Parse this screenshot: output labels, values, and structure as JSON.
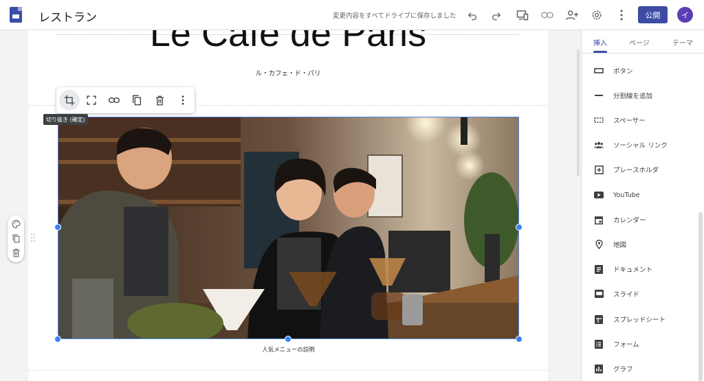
{
  "header": {
    "title": "レストラン",
    "save_status": "変更内容をすべてドライブに保存しました",
    "publish_label": "公開",
    "avatar_initial": "イ",
    "icons": [
      "undo-icon",
      "redo-icon",
      "preview-icon",
      "link-icon",
      "share-icon",
      "settings-icon",
      "more-icon"
    ]
  },
  "page": {
    "hero_title": "Le Café de Paris",
    "subtitle": "ル・カフェ・ド・パリ",
    "caption": "人気メニューの説明"
  },
  "image_toolbar": {
    "tooltip": "切り抜き (確定)",
    "buttons": [
      "crop-icon",
      "fullscreen-icon",
      "link-icon",
      "copy-icon",
      "delete-icon",
      "more-icon"
    ]
  },
  "left_tools": [
    "palette-icon",
    "copy-icon",
    "delete-icon"
  ],
  "sidebar": {
    "tabs": [
      {
        "label": "挿入",
        "active": true
      },
      {
        "label": "ページ",
        "active": false
      },
      {
        "label": "テーマ",
        "active": false
      }
    ],
    "items": [
      {
        "label": "ボタン",
        "icon": "button-icon"
      },
      {
        "label": "分割線を追加",
        "icon": "divider-icon"
      },
      {
        "label": "スペーサー",
        "icon": "spacer-icon"
      },
      {
        "label": "ソーシャル リンク",
        "icon": "social-icon"
      },
      {
        "label": "プレースホルダ",
        "icon": "placeholder-icon"
      },
      {
        "label": "YouTube",
        "icon": "youtube-icon"
      },
      {
        "label": "カレンダー",
        "icon": "calendar-icon"
      },
      {
        "label": "地図",
        "icon": "map-icon"
      },
      {
        "label": "ドキュメント",
        "icon": "document-icon"
      },
      {
        "label": "スライド",
        "icon": "slides-icon"
      },
      {
        "label": "スプレッドシート",
        "icon": "spreadsheet-icon"
      },
      {
        "label": "フォーム",
        "icon": "forms-icon"
      },
      {
        "label": "グラフ",
        "icon": "chart-icon"
      }
    ]
  },
  "colors": {
    "accent": "#3c4ba3",
    "selection": "#3b82f6",
    "avatar": "#5b3fb4"
  }
}
